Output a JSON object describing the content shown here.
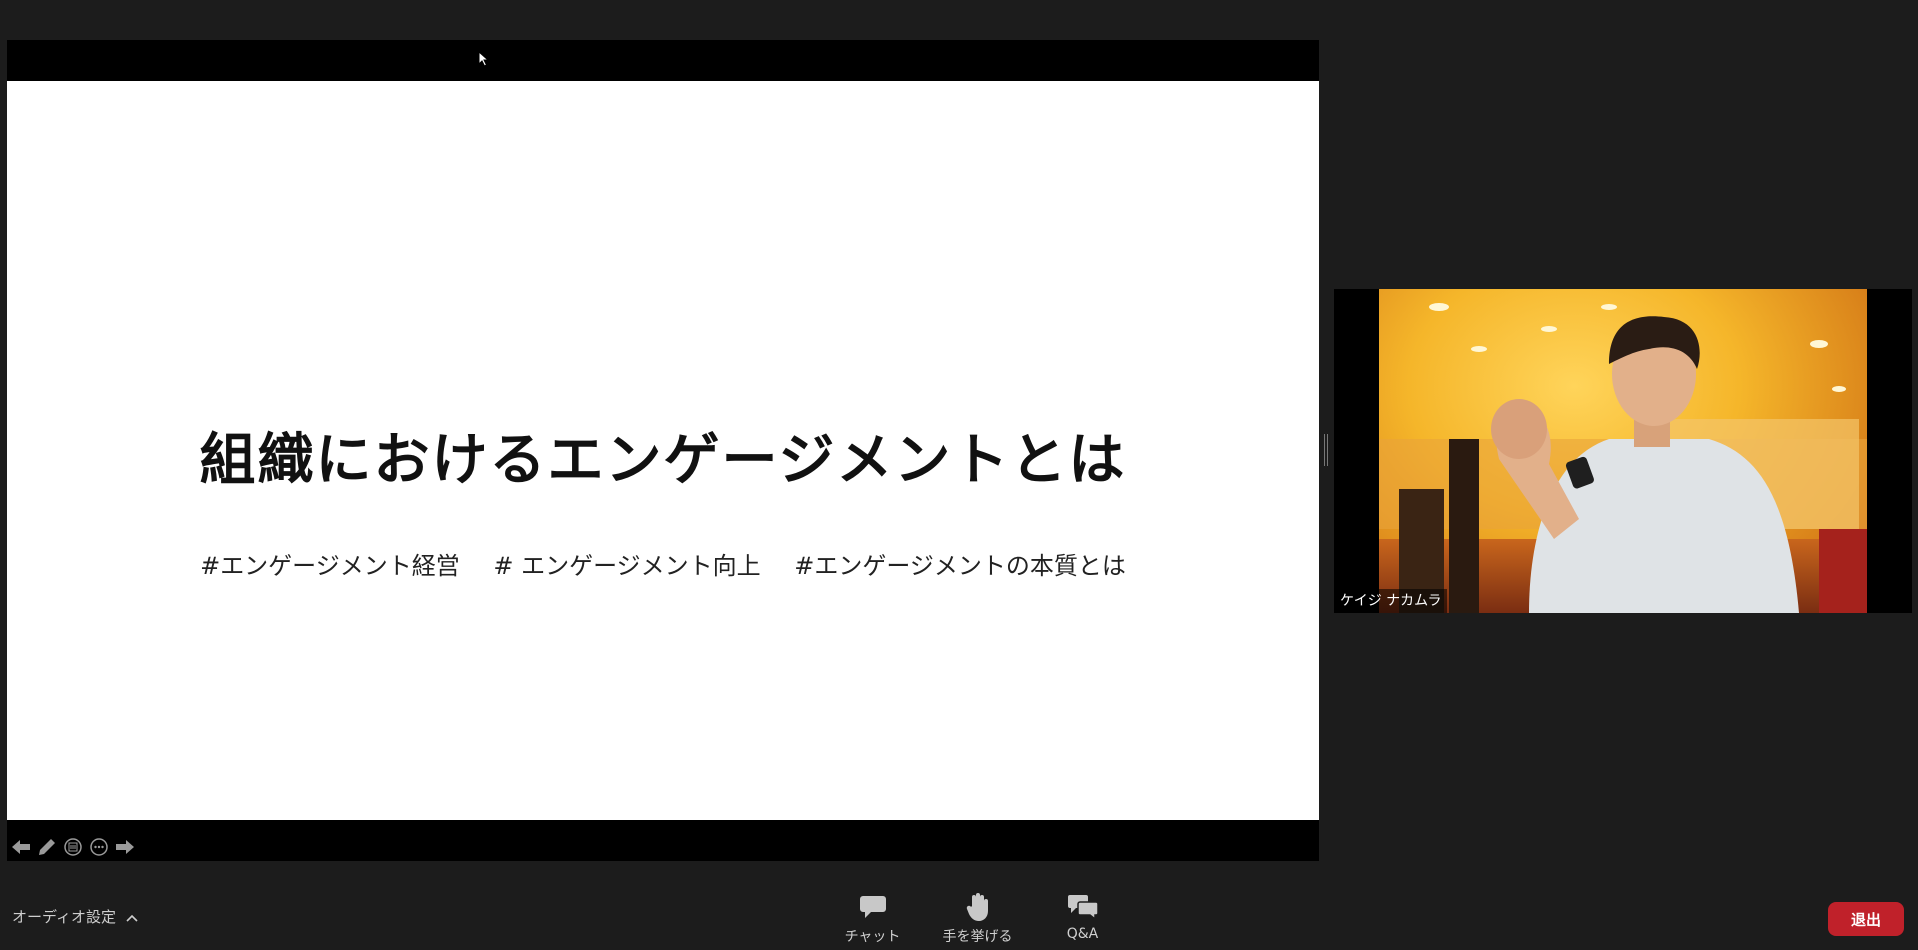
{
  "slide": {
    "title": "組織におけるエンゲージメントとは",
    "tags": [
      "#エンゲージメント経営",
      "# エンゲージメント向上",
      "#エンゲージメントの本質とは"
    ]
  },
  "slide_toolbar": {
    "icons": [
      "arrow-left-icon",
      "pen-icon",
      "notes-icon",
      "more-icon",
      "arrow-right-icon"
    ]
  },
  "participant": {
    "name": "ケイジ ナカムラ"
  },
  "bottom_bar": {
    "audio_settings_label": "オーディオ設定",
    "chat_label": "チャット",
    "raise_hand_label": "手を挙げる",
    "qa_label": "Q&A",
    "leave_label": "退出"
  },
  "colors": {
    "background": "#1c1c1c",
    "leave_button": "#c0212a"
  }
}
